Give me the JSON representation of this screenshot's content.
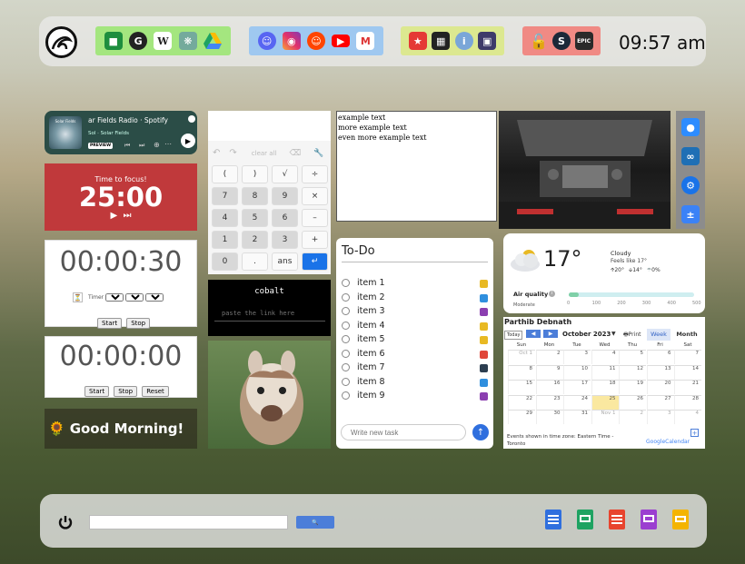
{
  "clock": {
    "time": "09:57 am"
  },
  "top_groups": [
    {
      "bg": "#a4e67f",
      "icons": [
        "contacts-icon",
        "github-icon",
        "wikipedia-icon",
        "chatgpt-icon",
        "drive-icon"
      ]
    },
    {
      "bg": "#9fc8f0",
      "icons": [
        "discord-icon",
        "instagram-icon",
        "reddit-icon",
        "youtube-icon",
        "gmail-icon"
      ]
    },
    {
      "bg": "#dce890",
      "icons": [
        "popcorn-icon",
        "museum-icon",
        "info-icon",
        "reader-icon"
      ]
    },
    {
      "bg": "#f08a84",
      "icons": [
        "unlock-icon",
        "steam-icon",
        "epic-games-icon"
      ]
    }
  ],
  "spotify": {
    "title": "ar Fields Radio · Spotify",
    "subtitle": "Sol · Solar Fields",
    "badge": "PREVIEW",
    "art_label": "Solar Fields"
  },
  "focus": {
    "caption": "Time to focus!",
    "time": "25:00"
  },
  "timer": {
    "display": "00:00:30",
    "label": "Timer",
    "h": "00",
    "m": "00",
    "s": "30",
    "start": "Start",
    "stop": "Stop"
  },
  "stopwatch": {
    "display": "00:00:00",
    "start": "Start",
    "stop": "Stop",
    "reset": "Reset"
  },
  "greeting": {
    "text": "Good Morning!",
    "emoji": "🌻"
  },
  "calculator": {
    "clear_all": "clear all",
    "keys": [
      [
        "(",
        ")",
        "√",
        "÷"
      ],
      [
        "7",
        "8",
        "9",
        "×"
      ],
      [
        "4",
        "5",
        "6",
        "–"
      ],
      [
        "1",
        "2",
        "3",
        "+"
      ],
      [
        "0",
        ".",
        "ans",
        "↵"
      ]
    ]
  },
  "cobalt": {
    "title": "cobalt",
    "placeholder": "paste the link here"
  },
  "notes": {
    "text": "example text\nmore example text\neven more example text"
  },
  "todo": {
    "title": "To-Do",
    "placeholder": "Write new task",
    "items": [
      {
        "label": "item 1",
        "color": "#e8b923"
      },
      {
        "label": "item 2",
        "color": "#2f8fde"
      },
      {
        "label": "item 3",
        "color": "#8b3fb0"
      },
      {
        "label": "item 4",
        "color": "#e8b923"
      },
      {
        "label": "item 5",
        "color": "#e8b923"
      },
      {
        "label": "item 6",
        "color": "#e0473a"
      },
      {
        "label": "item 7",
        "color": "#2c3e50"
      },
      {
        "label": "item 8",
        "color": "#2f8fde"
      },
      {
        "label": "item 9",
        "color": "#8b3fb0"
      }
    ]
  },
  "weather": {
    "temp": "17°",
    "condition": "Cloudy",
    "feels": "Feels like 17°",
    "high": "20°",
    "low": "14°",
    "precip": "0%",
    "aq_label": "Air quality",
    "aq_value": "Moderate",
    "aq_ticks": [
      "0",
      "100",
      "200",
      "300",
      "400",
      "500"
    ],
    "aq_fraction": 0.08
  },
  "calendar": {
    "owner": "Parthib Debnath",
    "today": "Today",
    "month": "October 2023",
    "print": "Print",
    "week": "Week",
    "month_btn": "Month",
    "days": [
      "Sun",
      "Mon",
      "Tue",
      "Wed",
      "Thu",
      "Fri",
      "Sat"
    ],
    "weeks": [
      [
        "",
        "Oct 1",
        "2",
        "3",
        "4",
        "5",
        "6",
        "7"
      ],
      [
        "",
        "8",
        "9",
        "10",
        "11",
        "12",
        "13",
        "14"
      ],
      [
        "",
        "15",
        "16",
        "17",
        "18",
        "19",
        "20",
        "21"
      ],
      [
        "",
        "22",
        "23",
        "24",
        "25",
        "26",
        "27",
        "28"
      ],
      [
        "",
        "29",
        "30",
        "31",
        "Nov 1",
        "2",
        "3",
        "4"
      ]
    ],
    "footer": "Events shown in time zone: Eastern Time - Toronto",
    "brand1": "Google",
    "brand2": "Calendar"
  },
  "side_icons": [
    "zoom-icon",
    "vscode-icon",
    "settings-icon",
    "calculator-icon"
  ],
  "bottom": {
    "search_button": "🔍",
    "docs": [
      "google-docs-icon",
      "google-sheets-icon",
      "google-forms-icon",
      "google-keep-icon",
      "google-slides-icon"
    ]
  }
}
